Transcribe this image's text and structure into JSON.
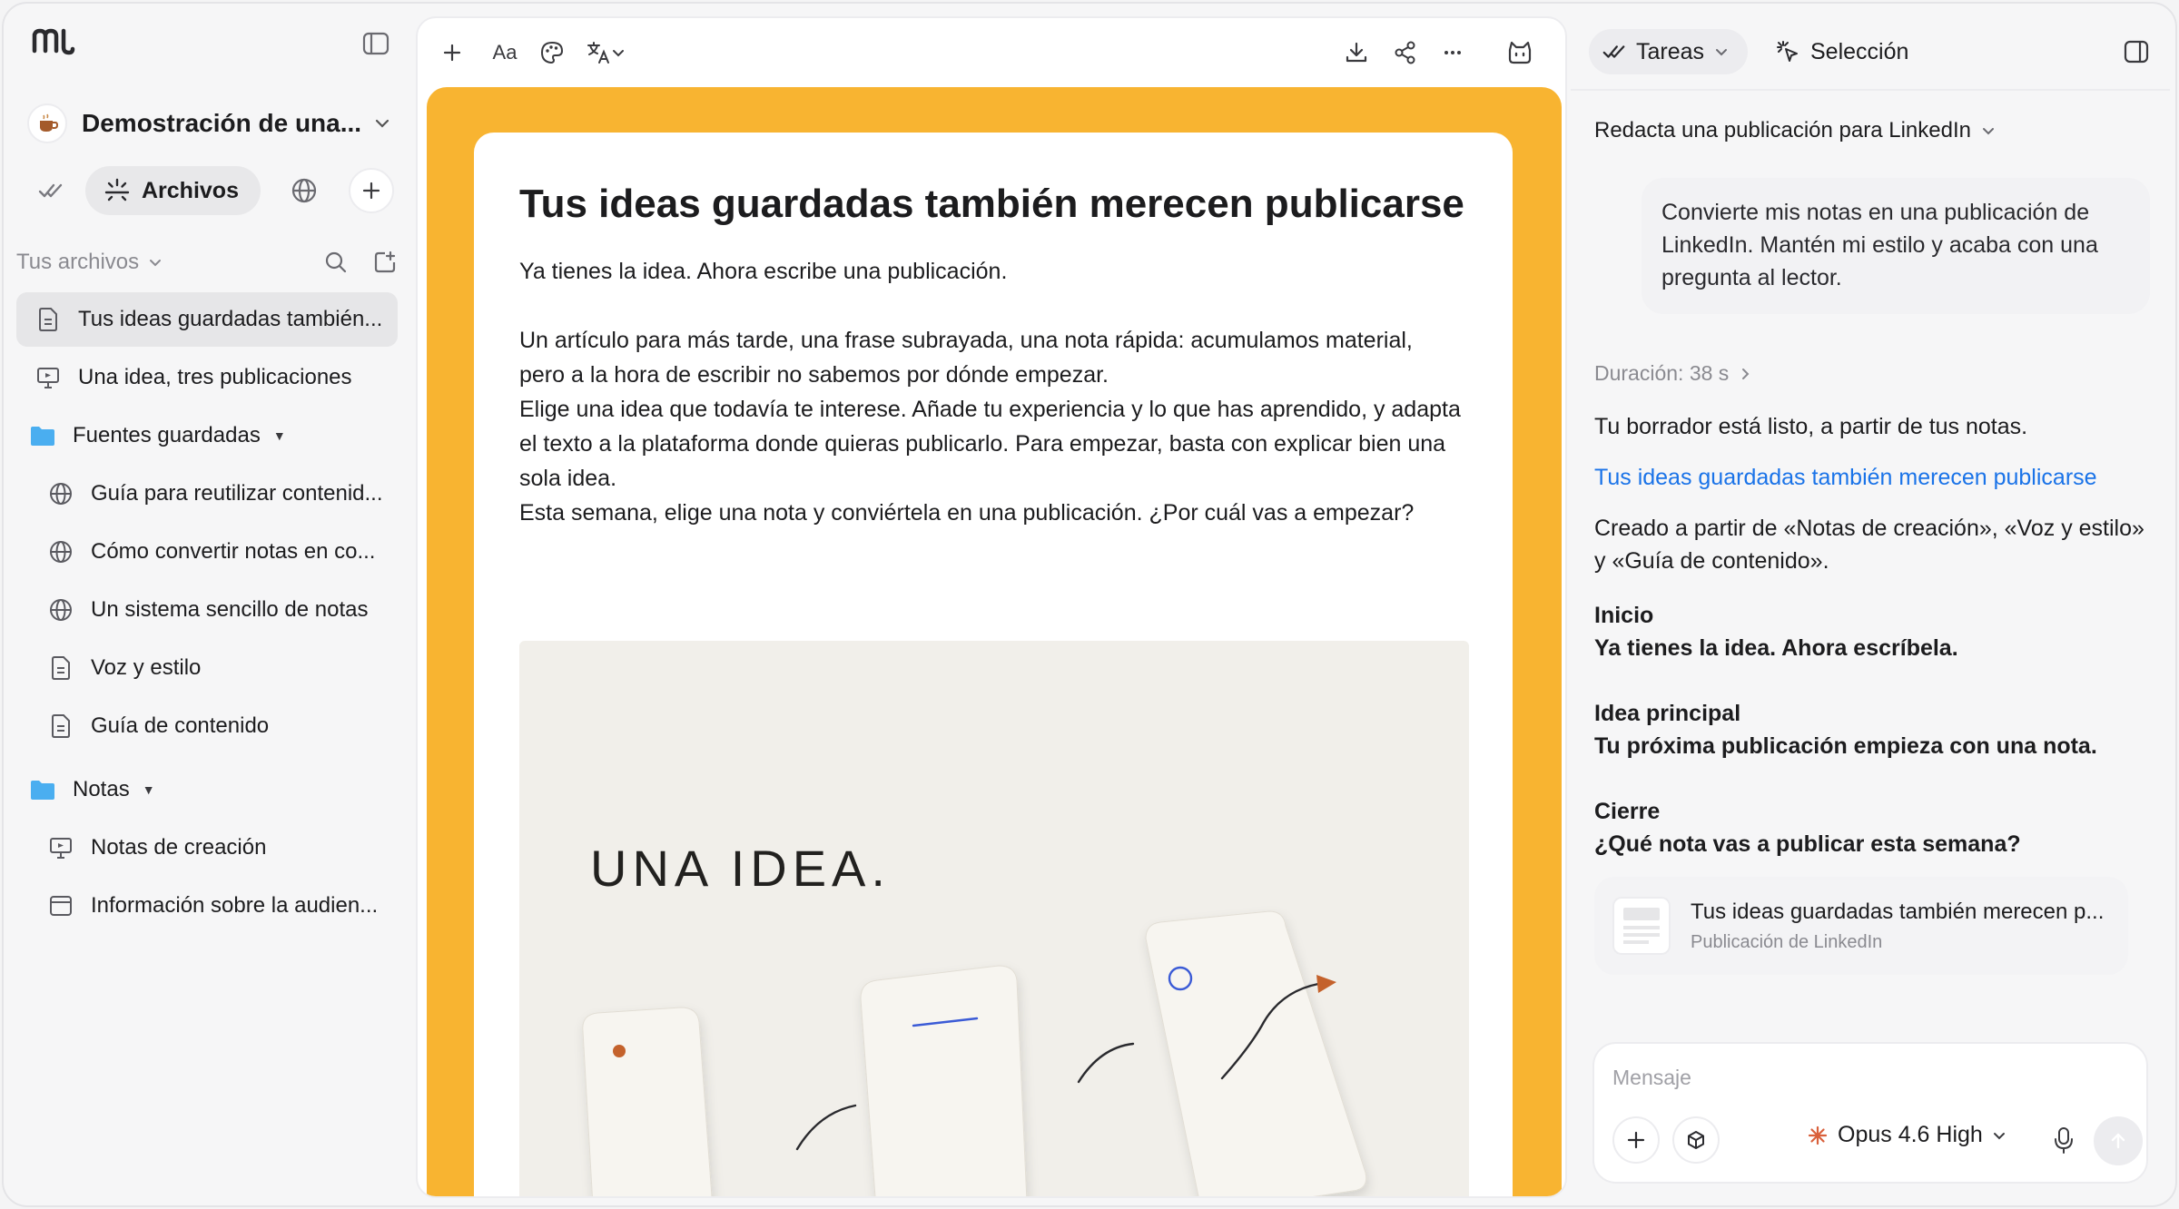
{
  "sidebar": {
    "workspace_title": "Demostración de una...",
    "nav_archivos_label": "Archivos",
    "files_header_label": "Tus archivos",
    "items": [
      {
        "label": "Tus ideas guardadas también...",
        "icon": "document-icon",
        "active": true
      },
      {
        "label": "Una idea, tres publicaciones",
        "icon": "presentation-icon"
      },
      {
        "label": "Fuentes guardadas",
        "icon": "folder-icon",
        "folder": true
      },
      {
        "label": "Guía para reutilizar contenid...",
        "icon": "globe-icon"
      },
      {
        "label": "Cómo convertir notas en co...",
        "icon": "globe-icon"
      },
      {
        "label": "Un sistema sencillo de notas",
        "icon": "globe-icon"
      },
      {
        "label": "Voz y estilo",
        "icon": "document-icon"
      },
      {
        "label": "Guía de contenido",
        "icon": "document-icon"
      },
      {
        "label": "Notas",
        "icon": "folder-icon",
        "folder": true
      },
      {
        "label": "Notas de creación",
        "icon": "presentation-icon"
      },
      {
        "label": "Información sobre la audien...",
        "icon": "window-icon"
      }
    ]
  },
  "editor": {
    "toolbar": {
      "font_label": "Aa"
    },
    "doc": {
      "title": "Tus ideas guardadas también merecen publicarse",
      "paragraphs": [
        "Ya tienes la idea. Ahora escribe una publicación.",
        "Un artículo para más tarde, una frase subrayada, una nota rápida: acumulamos material, pero a la hora de escribir no sabemos por dónde empezar.",
        "Elige una idea que todavía te interese. Añade tu experiencia y lo que has aprendido, y adapta el texto a la plataforma donde quieras publicarlo. Para empezar, basta con explicar bien una sola idea.",
        "Esta semana, elige una nota y conviértela en una publicación. ¿Por cuál vas a empezar?"
      ],
      "image_text": "UNA IDEA."
    },
    "accent_color": "#f8b431"
  },
  "panel": {
    "tab_tareas": "Tareas",
    "tab_seleccion": "Selección",
    "task_title": "Redacta una publicación para LinkedIn",
    "user_message": "Convierte mis notas en una publicación de LinkedIn. Mantén mi estilo y acaba con una pregunta al lector.",
    "duration": "Duración: 38 s",
    "response": {
      "intro": "Tu borrador está listo, a partir de tus notas.",
      "link": "Tus ideas guardadas también merecen publicarse",
      "sources": "Creado a partir de «Notas de creación», «Voz y estilo» y «Guía de contenido».",
      "inicio_label": "Inicio",
      "inicio_text": "Ya tienes la idea. Ahora escríbela.",
      "idea_label": "Idea principal",
      "idea_text": "Tu próxima publicación empieza con una nota.",
      "cierre_label": "Cierre",
      "cierre_text": "¿Qué nota vas a publicar esta semana?"
    },
    "attachment": {
      "name": "Tus ideas guardadas también merecen p...",
      "type": "Publicación de LinkedIn"
    },
    "composer": {
      "placeholder": "Mensaje",
      "model": "Opus 4.6 High"
    },
    "link_color": "#1a73e8"
  }
}
